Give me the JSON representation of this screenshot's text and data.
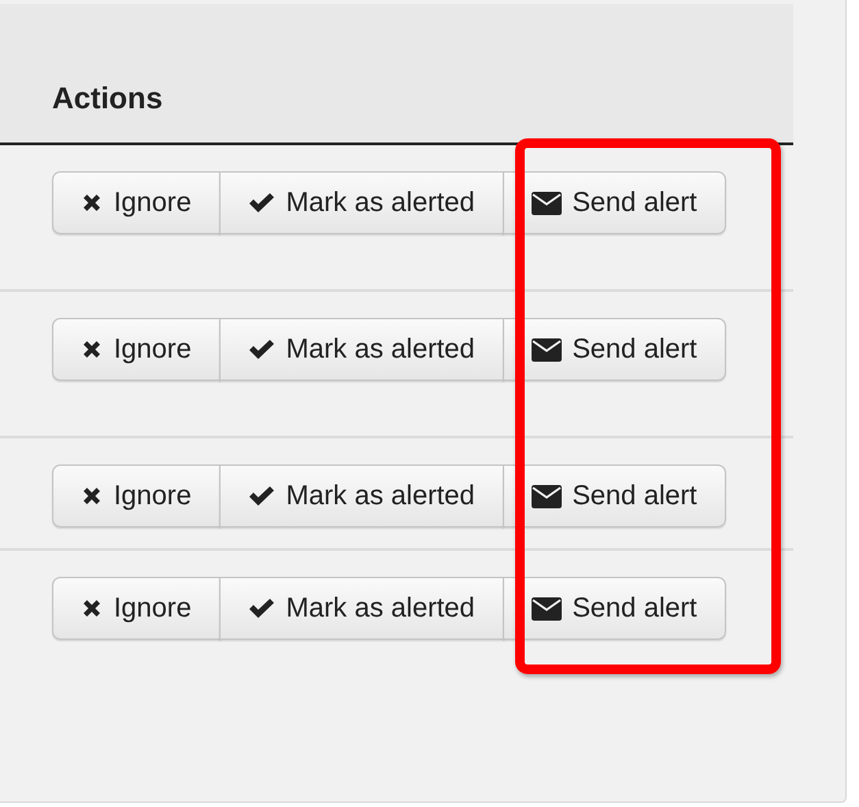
{
  "table": {
    "columns": [
      "Actions"
    ],
    "rows": [
      {
        "actions": [
          {
            "kind": "ignore",
            "label": "Ignore"
          },
          {
            "kind": "mark",
            "label": "Mark as alerted"
          },
          {
            "kind": "send",
            "label": "Send alert"
          }
        ]
      },
      {
        "actions": [
          {
            "kind": "ignore",
            "label": "Ignore"
          },
          {
            "kind": "mark",
            "label": "Mark as alerted"
          },
          {
            "kind": "send",
            "label": "Send alert"
          }
        ]
      },
      {
        "actions": [
          {
            "kind": "ignore",
            "label": "Ignore"
          },
          {
            "kind": "mark",
            "label": "Mark as alerted"
          },
          {
            "kind": "send",
            "label": "Send alert"
          }
        ]
      },
      {
        "actions": [
          {
            "kind": "ignore",
            "label": "Ignore"
          },
          {
            "kind": "mark",
            "label": "Mark as alerted"
          },
          {
            "kind": "send",
            "label": "Send alert"
          }
        ]
      }
    ]
  }
}
